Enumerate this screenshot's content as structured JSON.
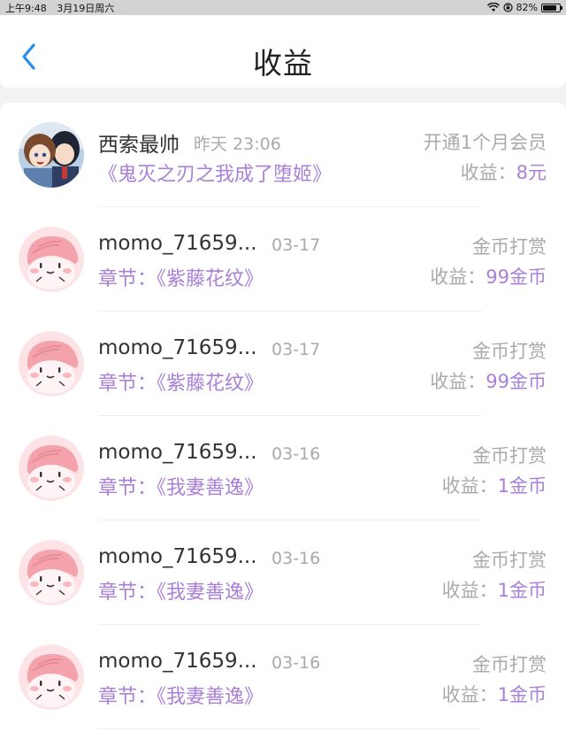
{
  "status_bar": {
    "time": "上午9:48",
    "date": "3月19日周六",
    "battery": "82%",
    "battery_level": 0.82
  },
  "header": {
    "title": "收益",
    "back_icon": "chevron-left-icon",
    "accent": "#2a8cf0"
  },
  "colors": {
    "purple": "#a880d8",
    "gray": "#aaaaaa"
  },
  "records": [
    {
      "name": "西索最帅",
      "date": "昨天 23:06",
      "content": "《鬼灭之刃之我成了堕姬》",
      "type": "开通1个月会员",
      "income_label": "收益：",
      "income_value": "8元",
      "avatar": "anime-avatar"
    },
    {
      "name": "momo_71659...",
      "date": "03-17",
      "content": "章节：《紫藤花纹》",
      "type": "金币打赏",
      "income_label": "收益：",
      "income_value": "99金币",
      "avatar": "pink-blob-avatar"
    },
    {
      "name": "momo_71659...",
      "date": "03-17",
      "content": "章节：《紫藤花纹》",
      "type": "金币打赏",
      "income_label": "收益：",
      "income_value": "99金币",
      "avatar": "pink-blob-avatar"
    },
    {
      "name": "momo_71659...",
      "date": "03-16",
      "content": "章节：《我妻善逸》",
      "type": "金币打赏",
      "income_label": "收益：",
      "income_value": "1金币",
      "avatar": "pink-blob-avatar"
    },
    {
      "name": "momo_71659...",
      "date": "03-16",
      "content": "章节：《我妻善逸》",
      "type": "金币打赏",
      "income_label": "收益：",
      "income_value": "1金币",
      "avatar": "pink-blob-avatar"
    },
    {
      "name": "momo_71659...",
      "date": "03-16",
      "content": "章节：《我妻善逸》",
      "type": "金币打赏",
      "income_label": "收益：",
      "income_value": "1金币",
      "avatar": "pink-blob-avatar"
    }
  ]
}
